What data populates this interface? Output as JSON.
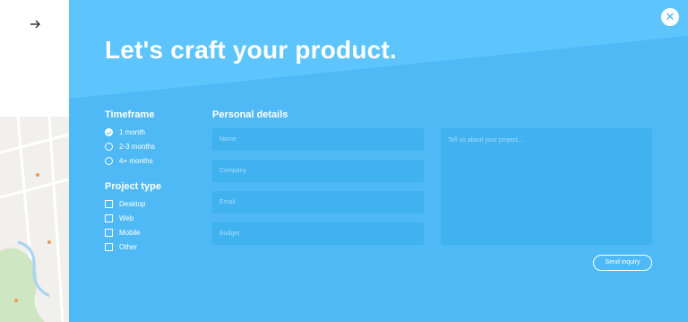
{
  "title": "Let's craft your product.",
  "timeframe": {
    "heading": "Timeframe",
    "options": [
      "1 month",
      "2-3 months",
      "4+ months"
    ],
    "selected": "1 month"
  },
  "project_type": {
    "heading": "Project type",
    "options": [
      "Desktop",
      "Web",
      "Mobile",
      "Other"
    ]
  },
  "personal": {
    "heading": "Personal details",
    "name_placeholder": "Name",
    "company_placeholder": "Company",
    "email_placeholder": "Email",
    "budget_placeholder": "Budget",
    "message_placeholder": "Tell us about your project..."
  },
  "send_label": "Send inquiry",
  "icons": {
    "back": "arrow-right-icon",
    "close": "close-icon"
  },
  "colors": {
    "panel": "#58c0fb",
    "field": "#3fb2ef"
  }
}
